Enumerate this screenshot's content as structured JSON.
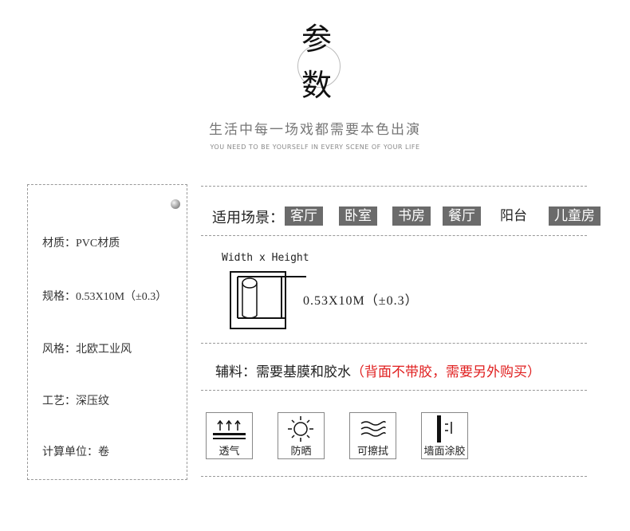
{
  "header": {
    "title_top": "参",
    "title_bottom": "数",
    "subtitle_cn": "生活中每一场戏都需要本色出演",
    "subtitle_en": "YOU NEED TO BE YOURSELF IN EVERY SCENE OF YOUR LIFE"
  },
  "specs": [
    {
      "label": "材质：",
      "value": "PVC材质"
    },
    {
      "label": "规格：",
      "value": "0.53X10M（±0.3）"
    },
    {
      "label": "风格：",
      "value": "北欧工业风"
    },
    {
      "label": "工艺：",
      "value": "深压纹"
    },
    {
      "label": "计算单位：",
      "value": "卷"
    }
  ],
  "scenes": {
    "label": "适用场景：",
    "tags": [
      "客厅",
      "卧室",
      "书房",
      "餐厅",
      "阳台",
      "儿童房"
    ]
  },
  "dimension": {
    "label": "Width x Height",
    "size": "0.53X10M（±0.3）"
  },
  "auxiliary": {
    "label": "辅料：需要基膜和胶水",
    "note": "（背面不带胶，需要另外购买）"
  },
  "features": [
    {
      "icon": "breathable-icon",
      "label": "透气"
    },
    {
      "icon": "sun-icon",
      "label": "防晒"
    },
    {
      "icon": "wipe-icon",
      "label": "可擦拭"
    },
    {
      "icon": "wall-glue-icon",
      "label": "墙面涂胶"
    }
  ],
  "colors": {
    "tag_bg": "#6b6b6b",
    "note_red": "#e02020"
  }
}
